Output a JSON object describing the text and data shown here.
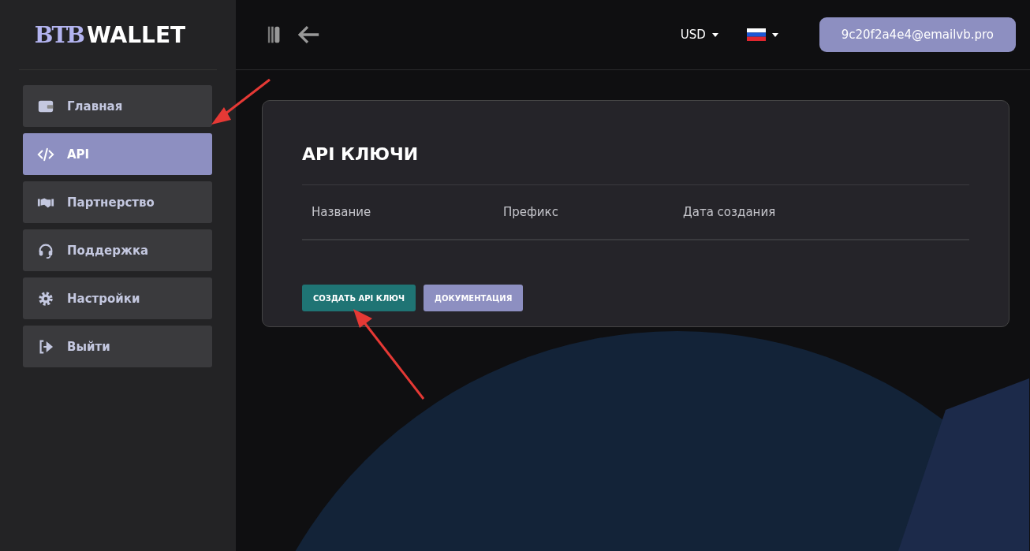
{
  "logo": {
    "mark": "BTB",
    "text": "WALLET"
  },
  "sidebar": {
    "items": [
      {
        "label": "Главная",
        "selected": false
      },
      {
        "label": "API",
        "selected": true
      },
      {
        "label": "Партнерство",
        "selected": false
      },
      {
        "label": "Поддержка",
        "selected": false
      },
      {
        "label": "Настройки",
        "selected": false
      },
      {
        "label": "Выйти",
        "selected": false
      }
    ]
  },
  "topbar": {
    "currency": "USD",
    "account": "9c20f2a4e4@emailvb.pro"
  },
  "card": {
    "title": "API КЛЮЧИ",
    "table": {
      "columns": [
        "Название",
        "Префикс",
        "Дата создания"
      ]
    },
    "buttons": [
      {
        "label": "СОЗДАТЬ API КЛЮЧ",
        "kind": "primary"
      },
      {
        "label": "ДОКУМЕНТАЦИЯ",
        "kind": "secondary"
      }
    ]
  }
}
